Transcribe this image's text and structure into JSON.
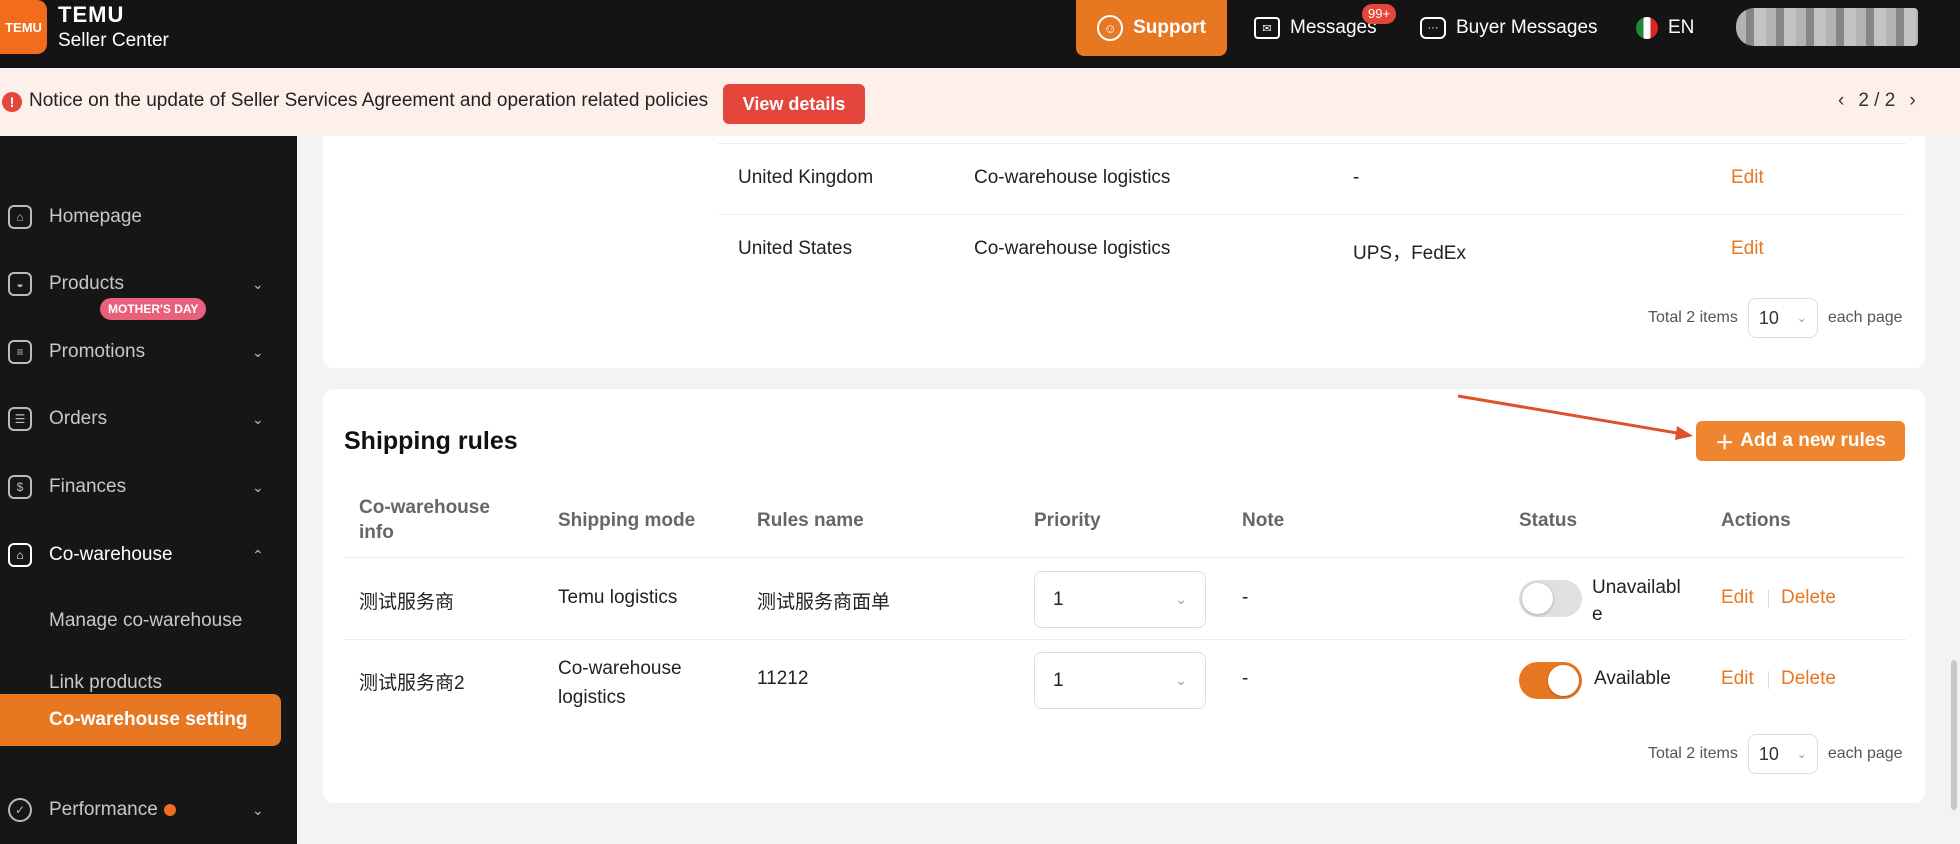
{
  "topbar": {
    "logo_text": "TEMU",
    "brand_title": "TEMU",
    "brand_subtitle": "Seller Center",
    "support_label": "Support",
    "messages_label": "Messages",
    "messages_badge": "99+",
    "buyer_messages_label": "Buyer Messages",
    "language": "EN"
  },
  "notice": {
    "text": "Notice on the update of Seller Services Agreement and operation related policies",
    "button": "View details",
    "page": "2 / 2"
  },
  "sidebar": {
    "items": [
      {
        "label": "Homepage",
        "icon": "home-icon"
      },
      {
        "label": "Products",
        "icon": "bag-icon"
      },
      {
        "label": "Promotions",
        "icon": "ticket-icon",
        "badge": "MOTHER'S DAY"
      },
      {
        "label": "Orders",
        "icon": "list-icon"
      },
      {
        "label": "Finances",
        "icon": "dollar-icon"
      },
      {
        "label": "Co-warehouse",
        "icon": "warehouse-icon"
      },
      {
        "label": "Performance",
        "icon": "chart-icon"
      }
    ],
    "subitems": [
      {
        "label": "Manage co-warehouse"
      },
      {
        "label": "Link products"
      },
      {
        "label": "Co-warehouse setting"
      }
    ]
  },
  "logistics_table": {
    "rows": [
      {
        "country": "United Kingdom",
        "mode": "Co-warehouse logistics",
        "carriers": "-",
        "action": "Edit"
      },
      {
        "country": "United States",
        "mode": "Co-warehouse logistics",
        "carriers": "UPS，FedEx",
        "action": "Edit"
      }
    ],
    "total": "Total 2 items",
    "page_size": "10",
    "each_page": "each page"
  },
  "shipping_rules": {
    "title": "Shipping rules",
    "add_button": "Add a new rules",
    "headers": [
      "Co-warehouse info",
      "Shipping mode",
      "Rules name",
      "Priority",
      "Note",
      "Status",
      "Actions"
    ],
    "rows": [
      {
        "info": "测试服务商",
        "mode": "Temu logistics",
        "rule": "测试服务商面单",
        "priority": "1",
        "note": "-",
        "status": "Unavailable",
        "status_on": false,
        "edit": "Edit",
        "delete": "Delete"
      },
      {
        "info": "测试服务商2",
        "mode": "Co-warehouse logistics",
        "rule": "11212",
        "priority": "1",
        "note": "-",
        "status": "Available",
        "status_on": true,
        "edit": "Edit",
        "delete": "Delete"
      }
    ],
    "total": "Total 2 items",
    "page_size": "10",
    "each_page": "each page"
  },
  "colors": {
    "accent": "#e87722",
    "danger": "#e5463c",
    "sidebar_bg": "#161616"
  }
}
